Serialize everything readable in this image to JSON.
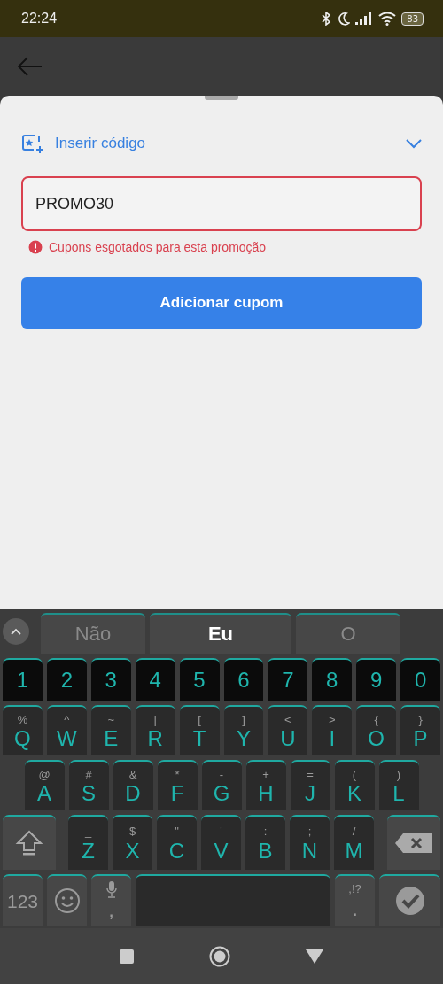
{
  "status_bar": {
    "time": "22:24",
    "battery": "83"
  },
  "coupon_sheet": {
    "section": {
      "title": "Inserir código",
      "expanded": true
    },
    "code_field": {
      "value": "PROMO30",
      "error": true
    },
    "error_message": "Cupons esgotados para esta promoção",
    "submit_button": "Adicionar cupom"
  },
  "keyboard": {
    "suggestions": [
      {
        "label": "Não",
        "emphasized": false
      },
      {
        "label": "Eu",
        "emphasized": true
      },
      {
        "label": "O",
        "emphasized": false
      }
    ],
    "rows": [
      [
        {
          "kind": "number",
          "label": "1"
        },
        {
          "kind": "number",
          "label": "2"
        },
        {
          "kind": "number",
          "label": "3"
        },
        {
          "kind": "number",
          "label": "4"
        },
        {
          "kind": "number",
          "label": "5"
        },
        {
          "kind": "number",
          "label": "6"
        },
        {
          "kind": "number",
          "label": "7"
        },
        {
          "kind": "number",
          "label": "8"
        },
        {
          "kind": "number",
          "label": "9"
        },
        {
          "kind": "number",
          "label": "0"
        }
      ],
      [
        {
          "kind": "letter",
          "label": "Q",
          "alt": "%"
        },
        {
          "kind": "letter",
          "label": "W",
          "alt": "^"
        },
        {
          "kind": "letter",
          "label": "E",
          "alt": "~"
        },
        {
          "kind": "letter",
          "label": "R",
          "alt": "|"
        },
        {
          "kind": "letter",
          "label": "T",
          "alt": "["
        },
        {
          "kind": "letter",
          "label": "Y",
          "alt": "]"
        },
        {
          "kind": "letter",
          "label": "U",
          "alt": "<"
        },
        {
          "kind": "letter",
          "label": "I",
          "alt": ">"
        },
        {
          "kind": "letter",
          "label": "O",
          "alt": "{"
        },
        {
          "kind": "letter",
          "label": "P",
          "alt": "}"
        }
      ],
      [
        {
          "kind": "letter",
          "label": "A",
          "alt": "@"
        },
        {
          "kind": "letter",
          "label": "S",
          "alt": "#"
        },
        {
          "kind": "letter",
          "label": "D",
          "alt": "&"
        },
        {
          "kind": "letter",
          "label": "F",
          "alt": "*"
        },
        {
          "kind": "letter",
          "label": "G",
          "alt": "-"
        },
        {
          "kind": "letter",
          "label": "H",
          "alt": "+"
        },
        {
          "kind": "letter",
          "label": "J",
          "alt": "="
        },
        {
          "kind": "letter",
          "label": "K",
          "alt": "("
        },
        {
          "kind": "letter",
          "label": "L",
          "alt": ")"
        }
      ],
      [
        {
          "kind": "shift"
        },
        {
          "kind": "letter",
          "label": "Z",
          "alt": "_"
        },
        {
          "kind": "letter",
          "label": "X",
          "alt": "$"
        },
        {
          "kind": "letter",
          "label": "C",
          "alt": "\""
        },
        {
          "kind": "letter",
          "label": "V",
          "alt": "'"
        },
        {
          "kind": "letter",
          "label": "B",
          "alt": ":"
        },
        {
          "kind": "letter",
          "label": "N",
          "alt": ";"
        },
        {
          "kind": "letter",
          "label": "M",
          "alt": "/"
        },
        {
          "kind": "backspace"
        }
      ],
      [
        {
          "kind": "symbols",
          "label": "123"
        },
        {
          "kind": "emoji"
        },
        {
          "kind": "comma",
          "label": ","
        },
        {
          "kind": "space"
        },
        {
          "kind": "period",
          "label": ".",
          "alt": ",!?"
        },
        {
          "kind": "enter"
        }
      ]
    ]
  }
}
